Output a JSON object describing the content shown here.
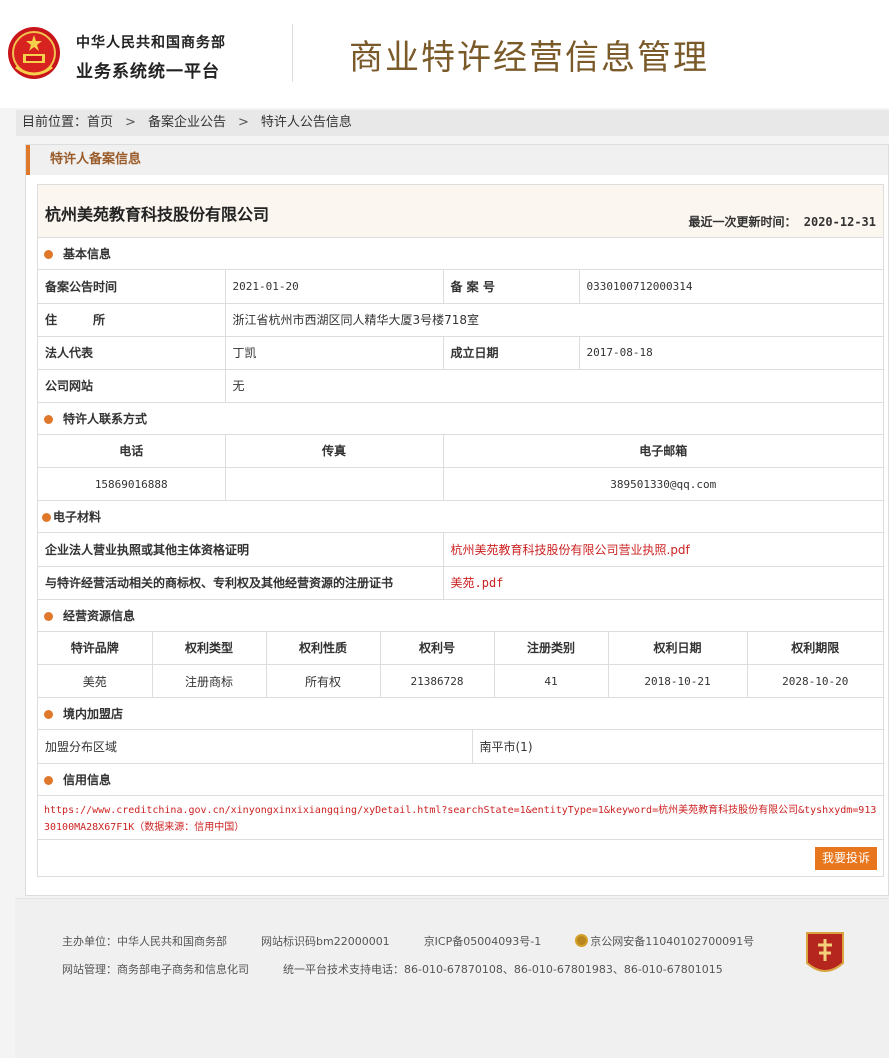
{
  "header": {
    "org_line1": "中华人民共和国商务部",
    "org_line2": "业务系统统一平台",
    "site_title": "商业特许经营信息管理"
  },
  "breadcrumb": {
    "prefix": "目前位置：",
    "items": [
      "首页",
      "备案企业公告",
      "特许人公告信息"
    ],
    "separator": ">"
  },
  "panel": {
    "title": "特许人备案信息",
    "company_name": "杭州美苑教育科技股份有限公司",
    "update_label": "最近一次更新时间：",
    "update_value": "2020-12-31"
  },
  "basic": {
    "heading": "基本信息",
    "announce_label": "备案公告时间",
    "announce_value": "2021-01-20",
    "record_no_label": "备 案 号",
    "record_no_value": "0330100712000314",
    "address_label": "住　　　所",
    "address_value": "浙江省杭州市西湖区同人精华大厦3号楼718室",
    "legal_label": "法人代表",
    "legal_value": "丁凯",
    "founded_label": "成立日期",
    "founded_value": "2017-08-18",
    "website_label": "公司网站",
    "website_value": "无"
  },
  "contact": {
    "heading": "特许人联系方式",
    "phone_label": "电话",
    "fax_label": "传真",
    "email_label": "电子邮箱",
    "phone_value": "15869016888",
    "fax_value": "",
    "email_value": "389501330@qq.com"
  },
  "materials": {
    "heading": "电子材料",
    "rows": [
      {
        "label": "企业法人营业执照或其他主体资格证明",
        "file": "杭州美苑教育科技股份有限公司营业执照.pdf"
      },
      {
        "label": "与特许经营活动相关的商标权、专利权及其他经营资源的注册证书",
        "file": "美苑.pdf"
      }
    ]
  },
  "resources": {
    "heading": "经营资源信息",
    "columns": [
      "特许品牌",
      "权利类型",
      "权利性质",
      "权利号",
      "注册类别",
      "权利日期",
      "权利期限"
    ],
    "rows": [
      [
        "美苑",
        "注册商标",
        "所有权",
        "21386728",
        "41",
        "2018-10-21",
        "2028-10-20"
      ]
    ]
  },
  "stores": {
    "heading": "境内加盟店",
    "area_label": "加盟分布区域",
    "area_value": "南平市(1)"
  },
  "credit": {
    "heading": "信用信息",
    "text": "https://www.creditchina.gov.cn/xinyongxinxixiangqing/xyDetail.html?searchState=1&entityType=1&keyword=杭州美苑教育科技股份有限公司&tyshxydm=91330100MA28X67F1K（数据来源：信用中国）"
  },
  "complain_button": "我要投诉",
  "footer": {
    "host": "主办单位：中华人民共和国商务部",
    "site_code": "网站标识码bm22000001",
    "icp": "京ICP备05004093号-1",
    "police": "京公网安备11040102700091号",
    "manager": "网站管理：商务部电子商务和信息化司",
    "support": "统一平台技术支持电话：86-010-67870108、86-010-67801983、86-010-67801015"
  },
  "colors": {
    "accent": "#e0782c",
    "title_brown": "#7b5a2a",
    "link_red": "#cc2222"
  }
}
